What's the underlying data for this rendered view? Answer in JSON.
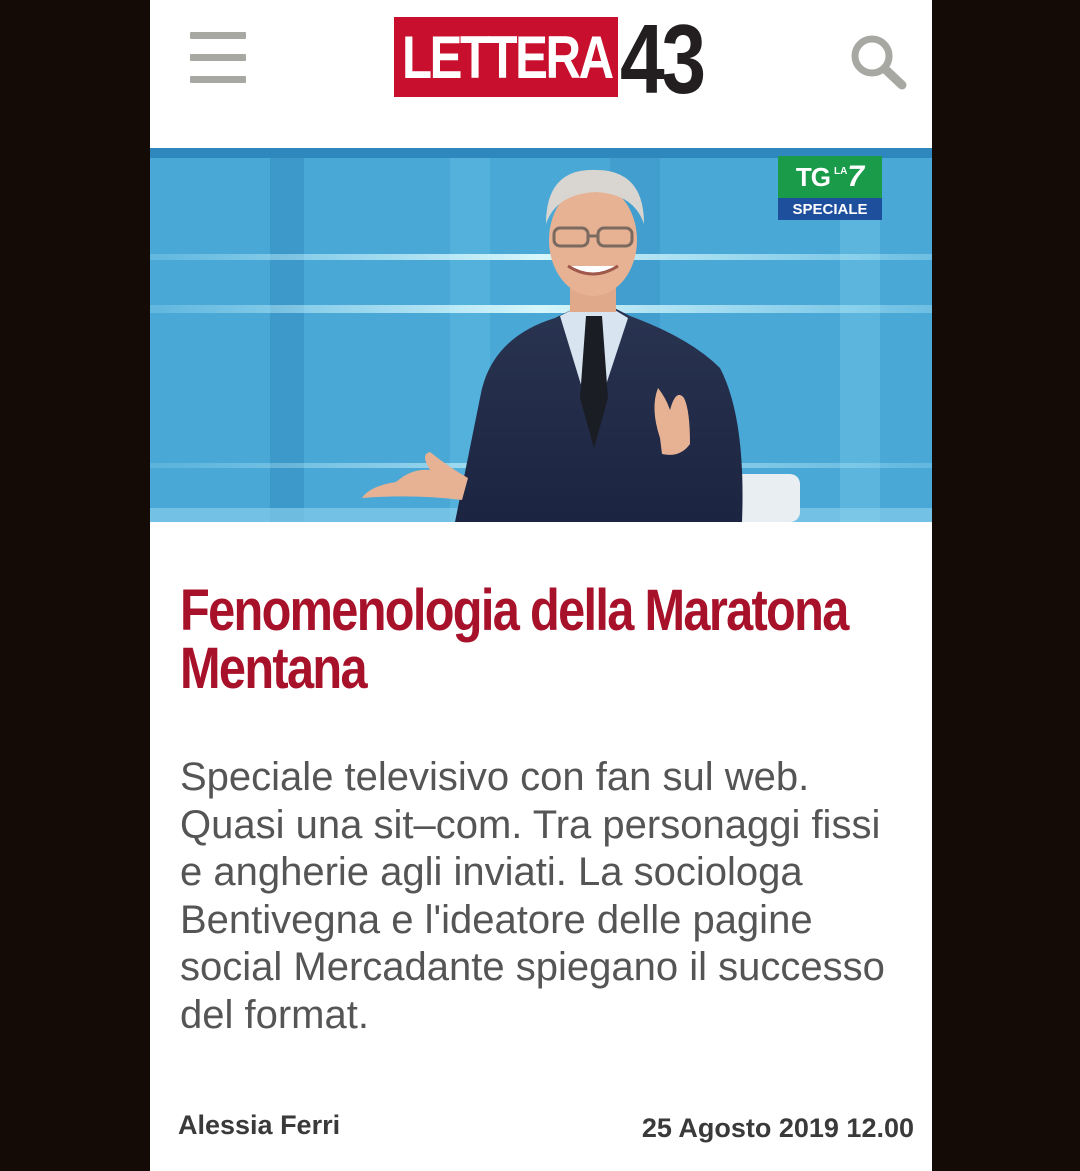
{
  "header": {
    "logo_word": "LETTERA",
    "logo_number": "43",
    "menu_icon": "hamburger-menu-icon",
    "search_icon": "search-icon",
    "brand_color": "#c8102e"
  },
  "hero": {
    "alt": "",
    "badge": {
      "brand": "TG",
      "la": "LA",
      "seven": "7",
      "label": "SPECIALE"
    }
  },
  "article": {
    "title": "Fenomenologia della Maratona Mentana",
    "summary": "Speciale televisivo con fan sul web. Quasi una sit–com. Tra personaggi fissi e angherie agli inviati. La sociologa Bentivegna e l'ideatore delle pagine social Mercadante spiegano il successo del format.",
    "author": "Alessia Ferri",
    "date": "25 Agosto 2019 12.00",
    "title_color": "#a8112a"
  }
}
